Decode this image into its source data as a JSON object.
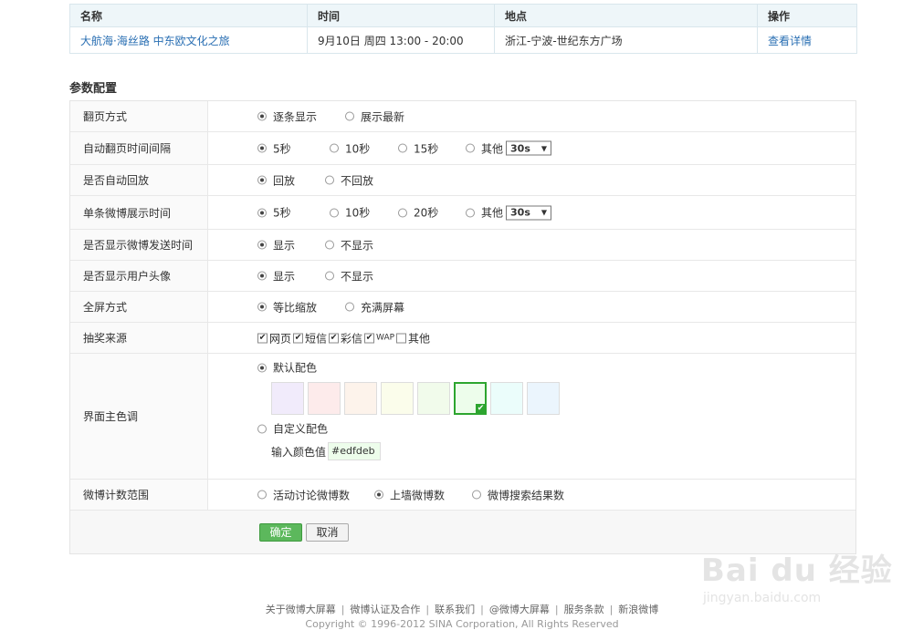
{
  "events": {
    "headers": [
      "名称",
      "时间",
      "地点",
      "操作"
    ],
    "rows": [
      {
        "name": "大航海·海丝路 中东欧文化之旅",
        "time": "9月10日 周四 13:00 - 20:00",
        "place": "浙江-宁波-世纪东方广场",
        "action": "查看详情"
      }
    ]
  },
  "section_title": "参数配置",
  "config": {
    "page_mode": {
      "label": "翻页方式",
      "options": [
        "逐条显示",
        "展示最新"
      ],
      "selected": 0
    },
    "auto_interval": {
      "label": "自动翻页时间间隔",
      "options": [
        "5秒",
        "10秒",
        "15秒",
        "其他"
      ],
      "selected": 0,
      "other_value": "30s"
    },
    "auto_replay": {
      "label": "是否自动回放",
      "options": [
        "回放",
        "不回放"
      ],
      "selected": 0
    },
    "single_time": {
      "label": "单条微博展示时间",
      "options": [
        "5秒",
        "10秒",
        "20秒",
        "其他"
      ],
      "selected": 0,
      "other_value": "30s"
    },
    "show_time": {
      "label": "是否显示微博发送时间",
      "options": [
        "显示",
        "不显示"
      ],
      "selected": 0
    },
    "show_avatar": {
      "label": "是否显示用户头像",
      "options": [
        "显示",
        "不显示"
      ],
      "selected": 0
    },
    "fullscreen": {
      "label": "全屏方式",
      "options": [
        "等比缩放",
        "充满屏幕"
      ],
      "selected": 0
    },
    "lottery_source": {
      "label": "抽奖来源",
      "options": [
        {
          "text": "网页",
          "checked": true
        },
        {
          "text": "短信",
          "checked": true
        },
        {
          "text": "彩信",
          "checked": true
        },
        {
          "text": "WAP",
          "checked": true
        },
        {
          "text": "其他",
          "checked": false
        }
      ]
    },
    "theme": {
      "label": "界面主色调",
      "default_label": "默认配色",
      "custom_label": "自定义配色",
      "input_label": "输入颜色值",
      "input_value": "#edfdeb",
      "selected_mode": "default",
      "swatches": [
        "#f1ebfb",
        "#fdebeb",
        "#fdf3eb",
        "#fbfdeb",
        "#f1fbeb",
        "#edfdeb",
        "#ebfdfb",
        "#ebf5fd"
      ],
      "selected_swatch": 5,
      "selected_color": "#2da52f"
    },
    "count_range": {
      "label": "微博计数范围",
      "options": [
        "活动讨论微博数",
        "上墙微博数",
        "微博搜索结果数"
      ],
      "selected": 1
    }
  },
  "buttons": {
    "ok": "确定",
    "cancel": "取消"
  },
  "footer": {
    "links": [
      "关于微博大屏幕",
      "微博认证及合作",
      "联系我们",
      "@微博大屏幕",
      "服务条款",
      "新浪微博"
    ],
    "copyright": "Copyright © 1996-2012 SINA Corporation, All Rights Reserved"
  },
  "watermark": {
    "brand": "Bai du 经验",
    "url": "jingyan.baidu.com"
  }
}
